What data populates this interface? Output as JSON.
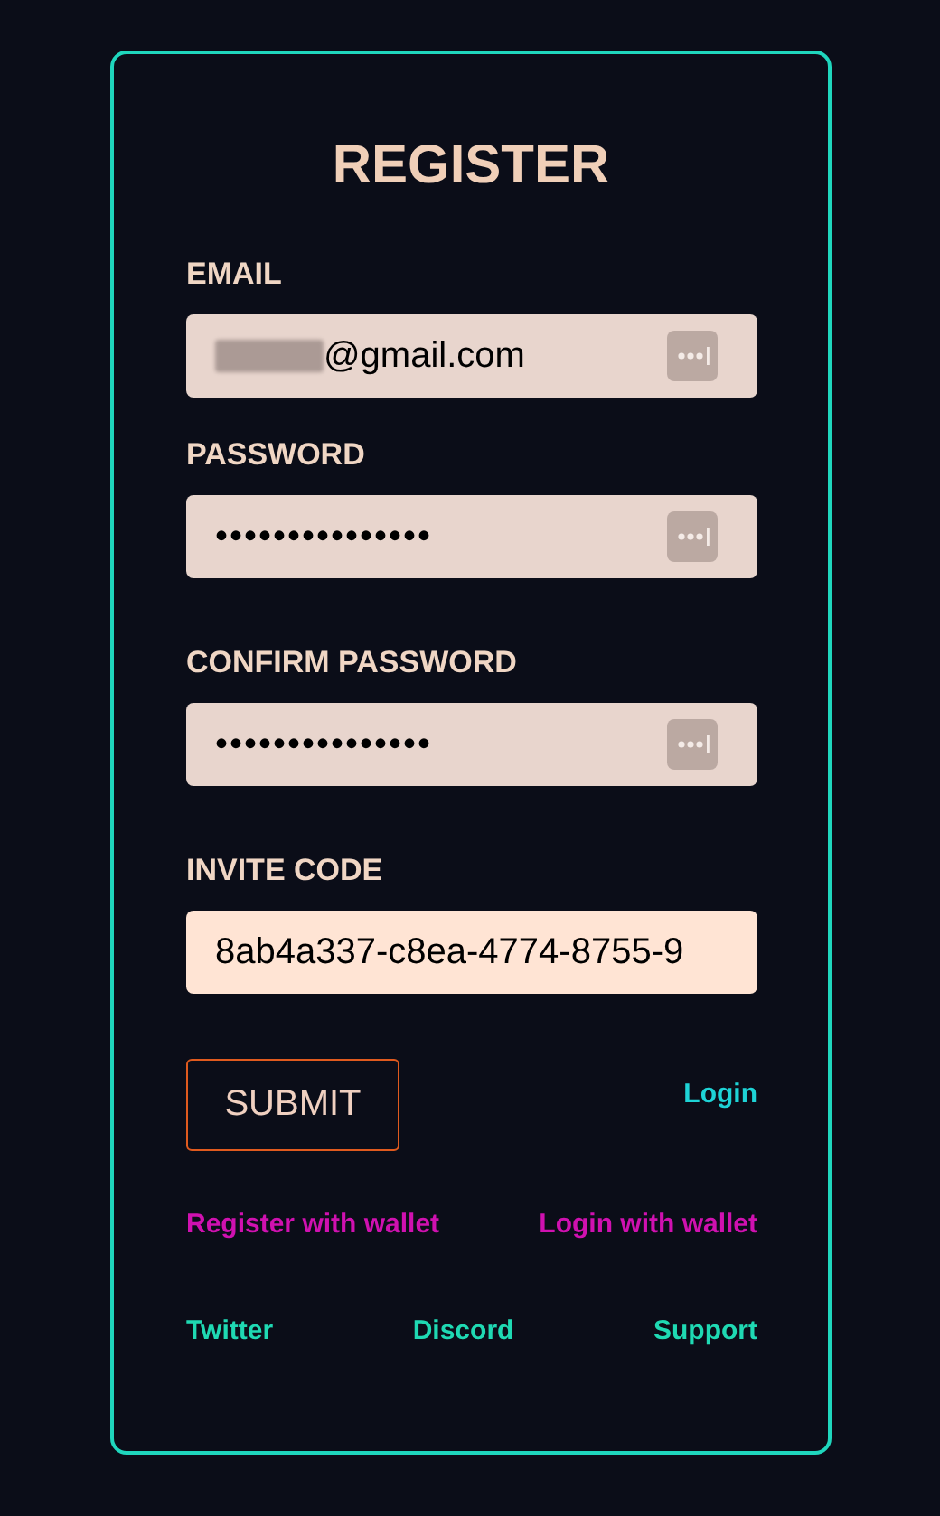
{
  "title": "REGISTER",
  "fields": [
    {
      "label": "EMAIL",
      "kind": "email",
      "value": "@gmail.com",
      "redacted": true,
      "key_icon": true
    },
    {
      "label": "PASSWORD",
      "kind": "password",
      "value": "•••••••••••••••",
      "redacted": false,
      "key_icon": true
    },
    {
      "label": "CONFIRM PASSWORD",
      "kind": "password",
      "value": "•••••••••••••••",
      "redacted": false,
      "key_icon": true
    },
    {
      "label": "INVITE CODE",
      "kind": "code",
      "value": "8ab4a337-c8ea-4774-8755-9",
      "redacted": false,
      "key_icon": false
    }
  ],
  "submit": "SUBMIT",
  "login": "Login",
  "wallet_links": [
    "Register with wallet",
    "Login with wallet"
  ],
  "social_links": [
    "Twitter",
    "Discord",
    "Support"
  ]
}
